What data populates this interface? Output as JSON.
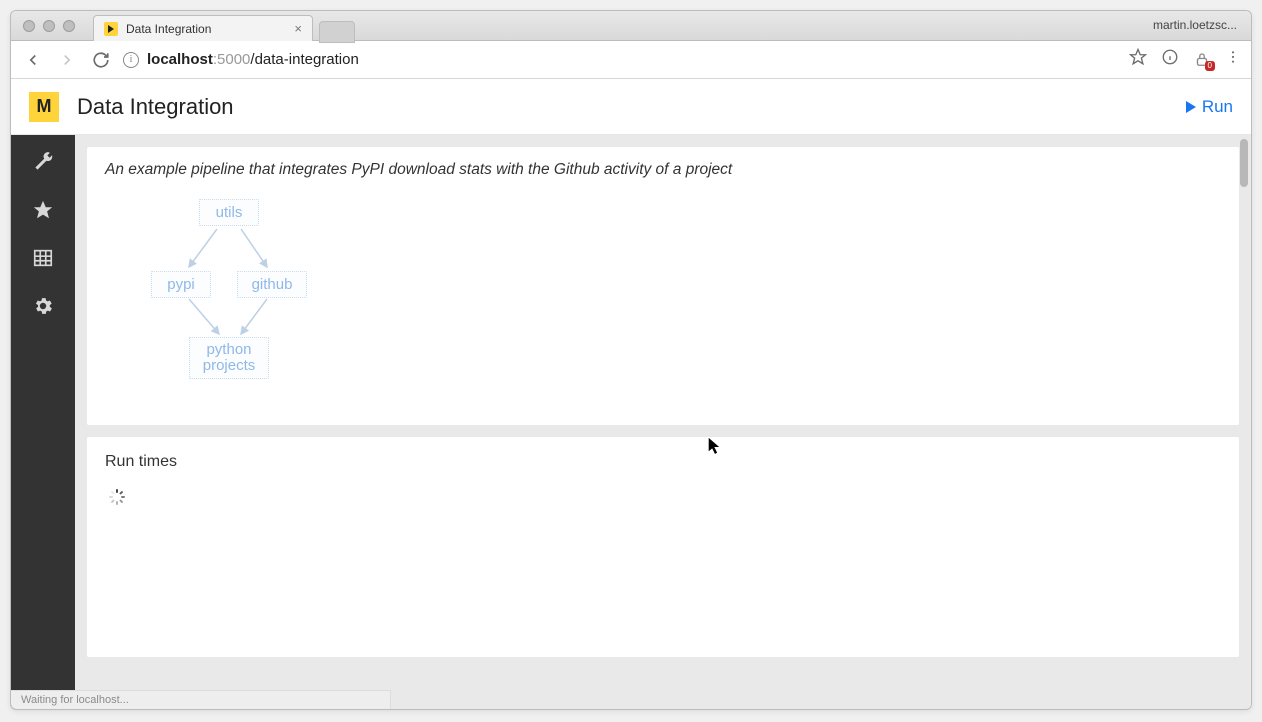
{
  "browser": {
    "profile_name": "martin.loetzsc...",
    "tab_title": "Data Integration",
    "url_host": "localhost",
    "url_port": ":5000",
    "url_path": "/data-integration",
    "ext_badge_count": "0",
    "status_text": "Waiting for localhost..."
  },
  "header": {
    "logo_letter": "M",
    "page_title": "Data Integration",
    "run_label": "Run"
  },
  "pipeline": {
    "description": "An example pipeline that integrates PyPI download stats with the Github activity of a project",
    "nodes": {
      "utils": "utils",
      "pypi": "pypi",
      "github": "github",
      "python_projects": "python\nprojects"
    }
  },
  "runtimes": {
    "title": "Run times"
  },
  "sidebar": {
    "items": [
      "tools",
      "favorites",
      "tables",
      "settings"
    ]
  }
}
